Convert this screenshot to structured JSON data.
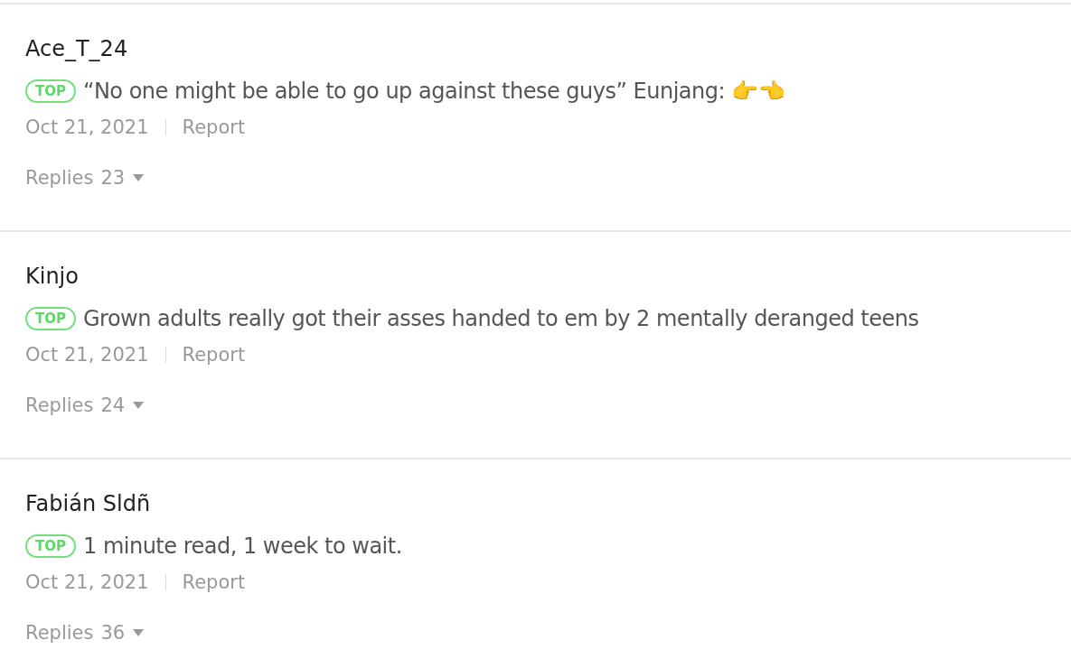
{
  "comments": [
    {
      "author": "Ace_T_24",
      "badge": "TOP",
      "text": "“No one might be able to go up against these guys” Eunjang: 👉👈",
      "date": "Oct 21, 2021",
      "report": "Report",
      "replies_label": "Replies",
      "replies_count": "23"
    },
    {
      "author": "Kinjo",
      "badge": "TOP",
      "text": "Grown adults really got their asses handed to em by 2 mentally deranged teens",
      "date": "Oct 21, 2021",
      "report": "Report",
      "replies_label": "Replies",
      "replies_count": "24"
    },
    {
      "author": "Fabián Sldñ",
      "badge": "TOP",
      "text": "1 minute read, 1 week to wait.",
      "date": "Oct 21, 2021",
      "report": "Report",
      "replies_label": "Replies",
      "replies_count": "36"
    }
  ]
}
